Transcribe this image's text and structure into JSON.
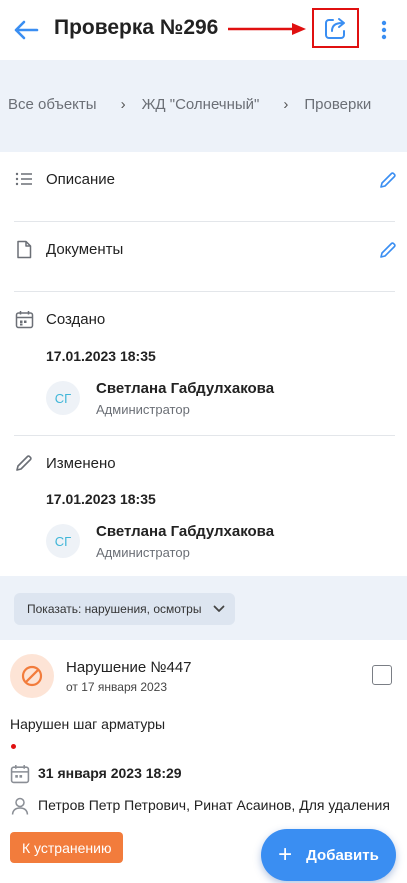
{
  "header": {
    "title": "Проверка №296",
    "back_icon": "arrow-left-icon",
    "share_icon": "share-icon",
    "more_icon": "more-vertical-icon"
  },
  "breadcrumb": {
    "items": [
      "Все объекты",
      "ЖД \"Солнечный\"",
      "Проверки"
    ]
  },
  "details": {
    "description_label": "Описание",
    "documents_label": "Документы",
    "created": {
      "label": "Создано",
      "date": "17.01.2023 18:35",
      "user": {
        "initials": "СГ",
        "name": "Светлана Габдулхакова",
        "role": "Администратор"
      }
    },
    "modified": {
      "label": "Изменено",
      "date": "17.01.2023 18:35",
      "user": {
        "initials": "СГ",
        "name": "Светлана Габдулхакова",
        "role": "Администратор"
      }
    }
  },
  "filter": {
    "label": "Показать: нарушения, осмотры"
  },
  "violation": {
    "title": "Нарушение №447",
    "date_sub": "от 17 января 2023",
    "description": "Нарушен шаг арматуры",
    "due": "31 января 2023 18:29",
    "assignees": "Петров Петр Петрович, Ринат Асаинов, Для удаления",
    "status": "К устранению"
  },
  "fab": {
    "label": "Добавить"
  },
  "colors": {
    "accent": "#3a8ef2",
    "status_orange": "#f27c3c",
    "annotation_red": "#e01010",
    "breadcrumb_bg": "#edf2f9"
  }
}
